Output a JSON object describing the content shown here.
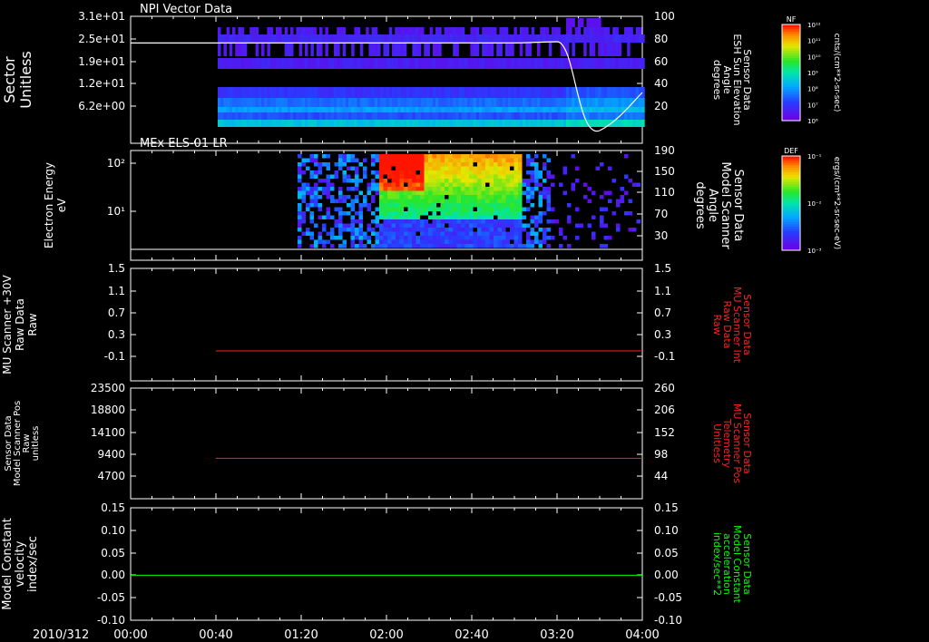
{
  "chart_data": [
    {
      "type": "heatmap",
      "title": "NPI Vector Data",
      "ylabel_lines": [
        "Sector",
        "Unitless"
      ],
      "y_ticks": [
        "3.1e+01",
        "2.5e+01",
        "1.9e+01",
        "1.2e+01",
        "6.2e+00"
      ],
      "right_label_lines": [
        "Sensor Data",
        "ESH Sun Elevation",
        "Angle",
        "degrees"
      ],
      "right_ticks": [
        "100",
        "80",
        "60",
        "40",
        "20"
      ],
      "ylim_right": [
        0,
        100
      ],
      "overlay_line": {
        "x": [
          "00:00",
          "03:00",
          "03:20",
          "03:40",
          "04:00"
        ],
        "y": [
          79,
          79,
          80,
          10,
          40
        ]
      },
      "colorbar": {
        "label": "NF",
        "units": "cnts/(cm**2-sr-sec)",
        "ticks": [
          "10¹²",
          "10¹¹",
          "10¹⁰",
          "10⁹",
          "10⁸",
          "10⁷",
          "10⁶"
        ]
      }
    },
    {
      "type": "heatmap",
      "title": "MEx ELS-01 LR",
      "ylabel_lines": [
        "Electron Energy",
        "eV"
      ],
      "y_ticks": [
        "10²",
        "10¹"
      ],
      "right_label_lines": [
        "Sensor Data",
        "Model Scanner",
        "Angle",
        "degrees"
      ],
      "right_ticks": [
        "190",
        "150",
        "110",
        "70",
        "30"
      ],
      "colorbar": {
        "label": "DEF",
        "units": "ergs/(cm**2-sr-sec-eV)",
        "ticks": [
          "10⁻¹",
          "10⁻²",
          "10⁻³"
        ]
      }
    },
    {
      "type": "line",
      "ylabel_lines": [
        "Sensor Data",
        "MU Scanner +30V",
        "Raw Data",
        "Raw"
      ],
      "y_ticks": [
        "1.5",
        "1.1",
        "0.7",
        "0.3",
        "-0.1"
      ],
      "ylim": [
        -0.3,
        1.5
      ],
      "right_label_lines": [
        "Sensor Data",
        "MU Scanner Int",
        "Raw Data",
        "Raw"
      ],
      "right_ticks": [
        "1.5",
        "1.1",
        "0.7",
        "0.3",
        "-0.1"
      ],
      "series": [
        {
          "x": [
            "00:40",
            "04:00"
          ],
          "values": [
            0.0,
            0.0
          ],
          "color": "#ff2020"
        }
      ]
    },
    {
      "type": "line",
      "ylabel_lines": [
        "Sensor Data",
        "Model Scanner Pos",
        "Raw",
        "unitless"
      ],
      "y_ticks": [
        "23500",
        "18800",
        "14100",
        "9400",
        "4700"
      ],
      "ylim": [
        0,
        23500
      ],
      "right_label_lines": [
        "Sensor Data",
        "MU Scanner Pos",
        "Telemetry",
        "Unitless"
      ],
      "right_ticks": [
        "260",
        "206",
        "152",
        "98",
        "44"
      ],
      "series": [
        {
          "x": [
            "00:40",
            "04:00"
          ],
          "values": [
            8500,
            8500
          ],
          "color": "#ff2020"
        }
      ]
    },
    {
      "type": "line",
      "ylabel_lines": [
        "Sensor Data",
        "Model Constant",
        "velocity",
        "index/sec"
      ],
      "y_ticks": [
        "0.15",
        "0.10",
        "0.05",
        "0.00",
        "-0.05",
        "-0.10"
      ],
      "ylim": [
        -0.1,
        0.15
      ],
      "right_label_lines": [
        "Sensor Data",
        "Model Constant",
        "acceleration",
        "index/sec**2"
      ],
      "right_ticks": [
        "0.15",
        "0.10",
        "0.05",
        "0.00",
        "-0.05",
        "-0.10"
      ],
      "series": [
        {
          "x": [
            "00:00",
            "04:00"
          ],
          "values": [
            0.0,
            0.0
          ],
          "color": "#00ff00"
        }
      ]
    }
  ],
  "x_axis": {
    "date_label": "2010/312",
    "ticks": [
      "00:00",
      "00:40",
      "01:20",
      "02:00",
      "02:40",
      "03:20",
      "04:00"
    ]
  },
  "colors": {
    "right_label_panel3": "#ff2020",
    "right_label_panel4": "#ff2020",
    "right_label_panel5": "#00ff00"
  }
}
